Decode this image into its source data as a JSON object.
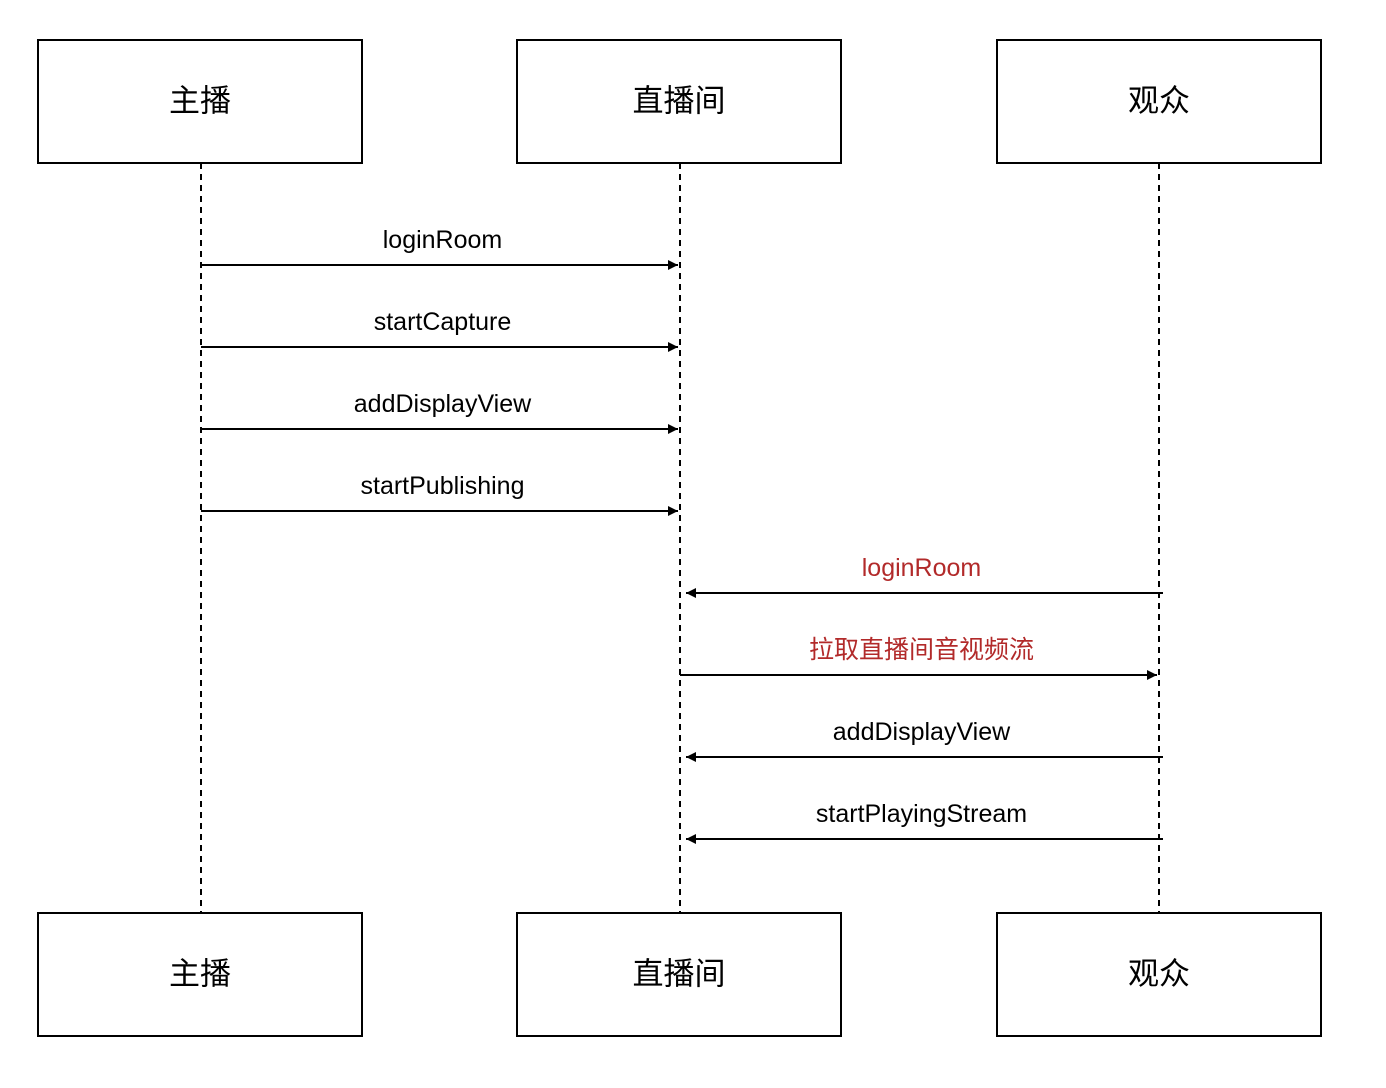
{
  "diagram": {
    "type": "sequence",
    "actors": [
      {
        "id": "host",
        "label": "主播"
      },
      {
        "id": "room",
        "label": "直播间"
      },
      {
        "id": "audience",
        "label": "观众"
      }
    ],
    "messages": [
      {
        "from": "host",
        "to": "room",
        "label": "loginRoom",
        "highlight": false
      },
      {
        "from": "host",
        "to": "room",
        "label": "startCapture",
        "highlight": false
      },
      {
        "from": "host",
        "to": "room",
        "label": "addDisplayView",
        "highlight": false
      },
      {
        "from": "host",
        "to": "room",
        "label": "startPublishing",
        "highlight": false
      },
      {
        "from": "audience",
        "to": "room",
        "label": "loginRoom",
        "highlight": true
      },
      {
        "from": "room",
        "to": "audience",
        "label": "拉取直播间音视频流",
        "highlight": true
      },
      {
        "from": "audience",
        "to": "room",
        "label": "addDisplayView",
        "highlight": false
      },
      {
        "from": "audience",
        "to": "room",
        "label": "startPlayingStream",
        "highlight": false
      }
    ]
  },
  "colors": {
    "line": "#000000",
    "text": "#000000",
    "highlight": "#b22a2a",
    "background": "#ffffff"
  }
}
